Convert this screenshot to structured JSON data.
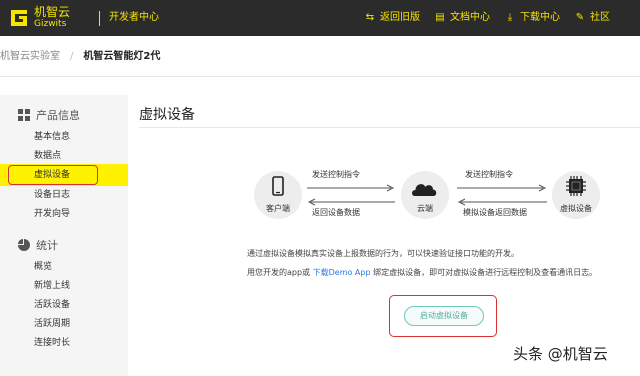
{
  "header": {
    "logo_cn": "机智云",
    "logo_en": "Gizwits",
    "dev_center": "开发者中心",
    "nav": [
      {
        "icon": "back-arrow-icon",
        "label": "返回旧版"
      },
      {
        "icon": "document-icon",
        "label": "文档中心"
      },
      {
        "icon": "download-icon",
        "label": "下载中心"
      },
      {
        "icon": "community-icon",
        "label": "社区"
      }
    ]
  },
  "breadcrumb": {
    "first": "机智云实验室",
    "separator": "/",
    "current": "机智云智能灯2代"
  },
  "sidebar": {
    "product_group": "产品信息",
    "product_items": [
      "基本信息",
      "数据点",
      "虚拟设备",
      "设备日志",
      "开发向导"
    ],
    "stats_group": "统计",
    "stats_items": [
      "概览",
      "新增上线",
      "活跃设备",
      "活跃周期",
      "连接时长"
    ],
    "active_item": "虚拟设备"
  },
  "main": {
    "title": "虚拟设备",
    "diagram": {
      "client": "客户端",
      "cloud": "云端",
      "virtual_device": "虚拟设备",
      "left_top": "发送控制指令",
      "left_bottom": "返回设备数据",
      "right_top": "发送控制指令",
      "right_bottom": "模拟设备返回数据"
    },
    "desc_line1": "通过虚拟设备模拟真实设备上报数据的行为，可以快速验证接口功能的开发。",
    "desc_line2_a": "用您开发的app或 ",
    "desc_line2_link": "下载Demo App",
    "desc_line2_b": " 绑定虚拟设备，即可对虚拟设备进行远程控制及查看通讯日志。",
    "start_button": "启动虚拟设备"
  },
  "watermark": "头条 @机智云",
  "colors": {
    "topbar_bg": "#2b2b2b",
    "brand_yellow": "#f5e400",
    "highlight_yellow": "#fff200",
    "annotation_red": "#d6332c",
    "link_blue": "#2a7ae2",
    "button_teal": "#5aa99d"
  }
}
